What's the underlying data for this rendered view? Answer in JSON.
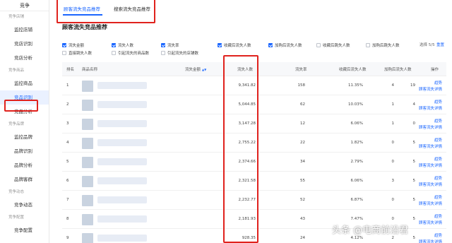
{
  "sidebar": {
    "title": "竞争",
    "groups": [
      {
        "label": "竞争店铺",
        "items": [
          {
            "label": "监控店铺"
          },
          {
            "label": "竞店识别"
          },
          {
            "label": "竞店分析"
          }
        ]
      },
      {
        "label": "竞争商品",
        "items": [
          {
            "label": "监控商品"
          },
          {
            "label": "竞品识别"
          },
          {
            "label": "竞品分析"
          }
        ]
      },
      {
        "label": "竞争品牌",
        "items": [
          {
            "label": "监控品牌"
          },
          {
            "label": "品牌识别"
          },
          {
            "label": "品牌分析"
          },
          {
            "label": "品牌客群"
          }
        ]
      },
      {
        "label": "竞争动态",
        "items": [
          {
            "label": "竞争动态"
          }
        ]
      },
      {
        "label": "竞争配置",
        "items": [
          {
            "label": "竞争配置"
          }
        ]
      }
    ]
  },
  "tabs": [
    {
      "label": "顾客流失竞品推荐"
    },
    {
      "label": "搜索流失竞品推荐"
    }
  ],
  "section_title": "顾客流失竞品推荐",
  "metrics": [
    {
      "label": "流失金额",
      "checked": true
    },
    {
      "label": "流失人数",
      "checked": true
    },
    {
      "label": "流失率",
      "checked": true
    },
    {
      "label": "收藏后流失人数",
      "checked": true
    },
    {
      "label": "加购后流失人数",
      "checked": true
    },
    {
      "label": "收藏后跳失人数",
      "checked": false
    },
    {
      "label": "加购后跳失人数",
      "checked": false
    },
    {
      "label": "直接跳失人数",
      "checked": false
    },
    {
      "label": "引起流失的商品数",
      "checked": false
    },
    {
      "label": "引起流失的店铺数",
      "checked": false
    }
  ],
  "select_count": "选择 5/5",
  "reset_label": "重置",
  "table": {
    "headers": {
      "rank": "排名",
      "name": "商品名称",
      "amount": "流失金额",
      "count": "流失人数",
      "rate": "流失率",
      "fav": "收藏后流失人数",
      "cart": "加购后流失人数",
      "ops": "操作"
    },
    "rows": [
      {
        "rank": "1",
        "amount": "9,341.82",
        "count": "158",
        "rate": "11.35%",
        "fav": "4",
        "cart": "19"
      },
      {
        "rank": "2",
        "amount": "5,044.85",
        "count": "62",
        "rate": "10.03%",
        "fav": "1",
        "cart": "4"
      },
      {
        "rank": "3",
        "amount": "3,147.28",
        "count": "12",
        "rate": "6.06%",
        "fav": "1",
        "cart": "0"
      },
      {
        "rank": "4",
        "amount": "2,755.22",
        "count": "22",
        "rate": "1.82%",
        "fav": "0",
        "cart": "5"
      },
      {
        "rank": "5",
        "amount": "2,374.66",
        "count": "34",
        "rate": "2.79%",
        "fav": "0",
        "cart": "5"
      },
      {
        "rank": "6",
        "amount": "2,321.58",
        "count": "55",
        "rate": "6.06%",
        "fav": "3",
        "cart": "5"
      },
      {
        "rank": "7",
        "amount": "2,232.77",
        "count": "52",
        "rate": "6.87%",
        "fav": "0",
        "cart": "5"
      },
      {
        "rank": "8",
        "amount": "2,181.93",
        "count": "43",
        "rate": "7.47%",
        "fav": "0",
        "cart": "5"
      },
      {
        "rank": "9",
        "amount": "928.35",
        "count": "24",
        "rate": "4.12%",
        "fav": "2",
        "cart": "5"
      }
    ],
    "op_trend": "趋势",
    "op_detail": "顾客流失详情"
  },
  "watermark": "头条 @电商前沿君",
  "colors": {
    "accent": "#1a66ff",
    "highlight": "#e0221d"
  }
}
